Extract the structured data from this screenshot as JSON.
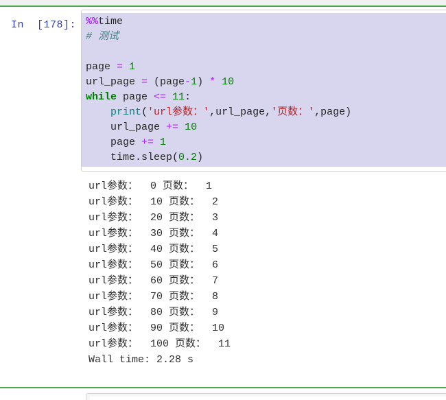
{
  "app": {
    "kind": "jupyter-notebook-cell",
    "accent_color": "#4aab4a",
    "code_bg": "#d8d5ee",
    "prompt_color": "#303f9f"
  },
  "cell": {
    "prompt_label": "In  [178]:",
    "execution_count": 178,
    "code_lines": [
      [
        {
          "t": "%%",
          "c": "magic"
        },
        {
          "t": "time",
          "c": "plain"
        }
      ],
      [
        {
          "t": "# 测试",
          "c": "comment"
        }
      ],
      [],
      [
        {
          "t": "page ",
          "c": "plain"
        },
        {
          "t": "=",
          "c": "op"
        },
        {
          "t": " ",
          "c": "plain"
        },
        {
          "t": "1",
          "c": "num"
        }
      ],
      [
        {
          "t": "url_page ",
          "c": "plain"
        },
        {
          "t": "=",
          "c": "op"
        },
        {
          "t": " (page",
          "c": "plain"
        },
        {
          "t": "-",
          "c": "op"
        },
        {
          "t": "1",
          "c": "num"
        },
        {
          "t": ") ",
          "c": "plain"
        },
        {
          "t": "*",
          "c": "op"
        },
        {
          "t": " ",
          "c": "plain"
        },
        {
          "t": "10",
          "c": "num"
        }
      ],
      [
        {
          "t": "while",
          "c": "kw"
        },
        {
          "t": " page ",
          "c": "plain"
        },
        {
          "t": "<=",
          "c": "op"
        },
        {
          "t": " ",
          "c": "plain"
        },
        {
          "t": "11",
          "c": "num"
        },
        {
          "t": ":",
          "c": "plain"
        }
      ],
      [
        {
          "t": "    ",
          "c": "plain"
        },
        {
          "t": "print",
          "c": "fn"
        },
        {
          "t": "(",
          "c": "punct"
        },
        {
          "t": "'url参数：'",
          "c": "str"
        },
        {
          "t": ",url_page,",
          "c": "plain"
        },
        {
          "t": "'页数：'",
          "c": "str"
        },
        {
          "t": ",page)",
          "c": "plain"
        }
      ],
      [
        {
          "t": "    url_page ",
          "c": "plain"
        },
        {
          "t": "+=",
          "c": "op"
        },
        {
          "t": " ",
          "c": "plain"
        },
        {
          "t": "10",
          "c": "num"
        }
      ],
      [
        {
          "t": "    page ",
          "c": "plain"
        },
        {
          "t": "+=",
          "c": "op"
        },
        {
          "t": " ",
          "c": "plain"
        },
        {
          "t": "1",
          "c": "num"
        }
      ],
      [
        {
          "t": "    time.sleep(",
          "c": "plain"
        },
        {
          "t": "0.2",
          "c": "num"
        },
        {
          "t": ")",
          "c": "plain"
        }
      ]
    ]
  },
  "output": {
    "stream_lines": [
      "url参数：  0 页数：  1",
      "url参数：  10 页数：  2",
      "url参数：  20 页数：  3",
      "url参数：  30 页数：  4",
      "url参数：  40 页数：  5",
      "url参数：  50 页数：  6",
      "url参数：  60 页数：  7",
      "url参数：  70 页数：  8",
      "url参数：  80 页数：  9",
      "url参数：  90 页数：  10",
      "url参数：  100 页数：  11",
      "Wall time: 2.28 s"
    ],
    "wall_time": "2.28 s"
  }
}
